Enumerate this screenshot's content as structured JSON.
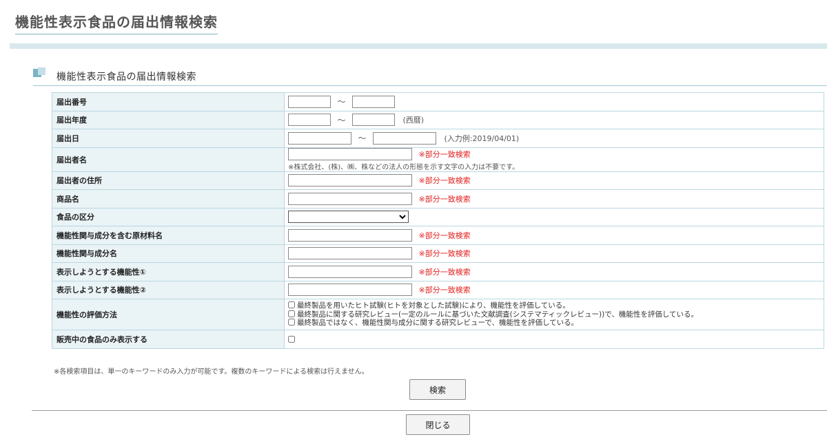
{
  "page_title": "機能性表示食品の届出情報検索",
  "section_title": "機能性表示食品の届出情報検索",
  "fields": {
    "notification_number": {
      "label": "届出番号",
      "separator": "～"
    },
    "notification_year": {
      "label": "届出年度",
      "separator": "～",
      "hint": "(西暦)"
    },
    "notification_date": {
      "label": "届出日",
      "separator": "～",
      "hint": "(入力例:2019/04/01)"
    },
    "notifier_name": {
      "label": "届出者名",
      "partial_note": "※部分一致検索",
      "note": "※株式会社、(株)、㈱、株などの法人の形態を示す文字の入力は不要です。"
    },
    "notifier_address": {
      "label": "届出者の住所",
      "partial_note": "※部分一致検索"
    },
    "product_name": {
      "label": "商品名",
      "partial_note": "※部分一致検索"
    },
    "food_category": {
      "label": "食品の区分",
      "selected": ""
    },
    "raw_material": {
      "label": "機能性関与成分を含む原材料名",
      "partial_note": "※部分一致検索"
    },
    "ingredient_name": {
      "label": "機能性関与成分名",
      "partial_note": "※部分一致検索"
    },
    "claim_1": {
      "label": "表示しようとする機能性①",
      "partial_note": "※部分一致検索"
    },
    "claim_2": {
      "label": "表示しようとする機能性②",
      "partial_note": "※部分一致検索"
    },
    "evaluation_method": {
      "label": "機能性の評価方法",
      "options": [
        "最終製品を用いたヒト試験(ヒトを対象とした試験)により、機能性を評価している。",
        "最終製品に関する研究レビュー(一定のルールに基づいた文献調査(システマティックレビュー))で、機能性を評価している。",
        "最終製品ではなく、機能性関与成分に関する研究レビューで、機能性を評価している。"
      ]
    },
    "on_sale_only": {
      "label": "販売中の食品のみ表示する"
    }
  },
  "footnote": "※各検索項目は、単一のキーワードのみ入力が可能です。複数のキーワードによる検索は行えません。",
  "buttons": {
    "search": "検索",
    "close": "閉じる"
  }
}
